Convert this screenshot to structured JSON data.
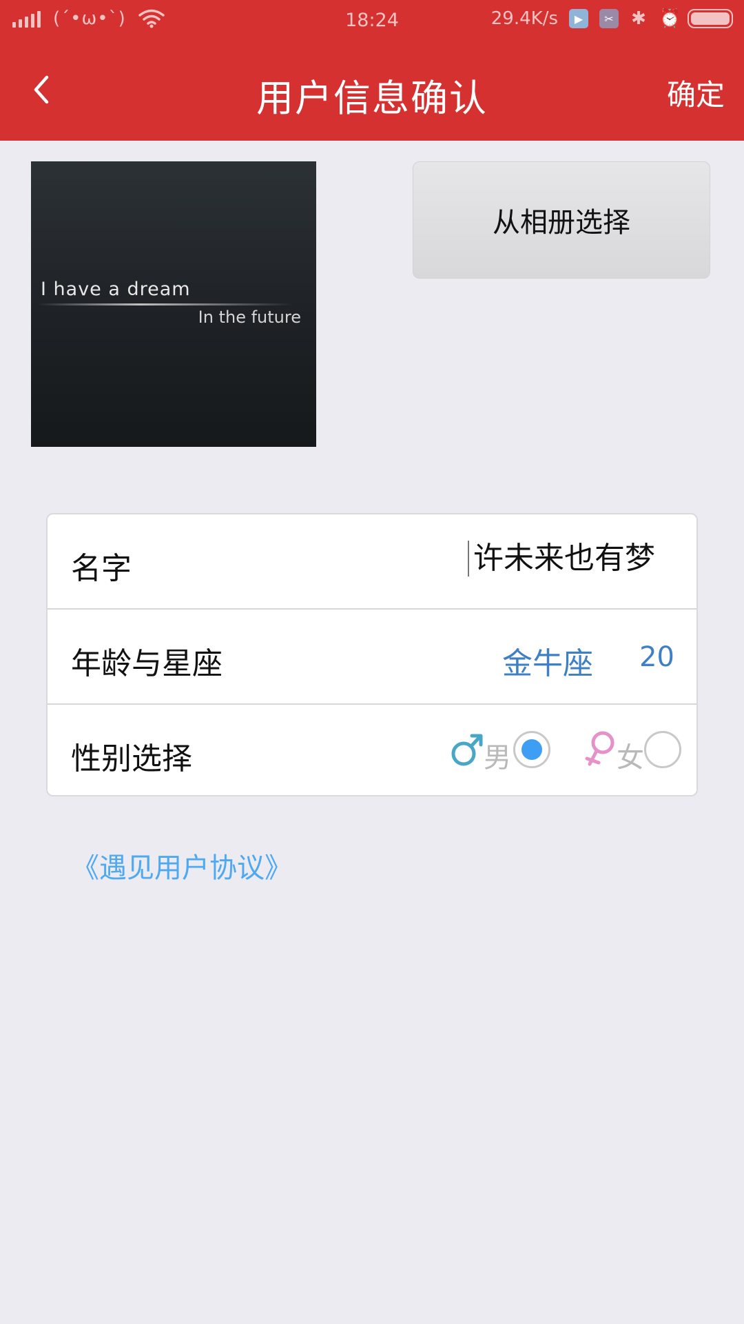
{
  "status_bar": {
    "kaomoji": "(´•ω•`)",
    "time": "18:24",
    "net_speed": "29.4K/s",
    "icons": [
      "signal-icon",
      "wifi-icon",
      "play-icon",
      "app-icon",
      "bluetooth-icon",
      "alarm-icon",
      "battery-icon"
    ]
  },
  "header": {
    "title": "用户信息确认",
    "confirm_label": "确定",
    "back_icon": "chevron-left-icon",
    "background": "#d53131"
  },
  "avatar": {
    "line1": "I have a dream",
    "line2": "In the future"
  },
  "album_button": {
    "label": "从相册选择"
  },
  "form": {
    "name": {
      "label": "名字",
      "value": "许未来也有梦"
    },
    "age_zodiac": {
      "label": "年龄与星座",
      "zodiac": "金牛座",
      "age": "20"
    },
    "gender": {
      "label": "性别选择",
      "male_label": "男",
      "female_label": "女",
      "selected": "男"
    }
  },
  "agreement": {
    "link_text": "《遇见用户协议》"
  },
  "colors": {
    "accent": "#d53131",
    "link": "#4ea9f0",
    "value_blue": "#3f7fc4",
    "radio_selected": "#3e9ef4"
  }
}
